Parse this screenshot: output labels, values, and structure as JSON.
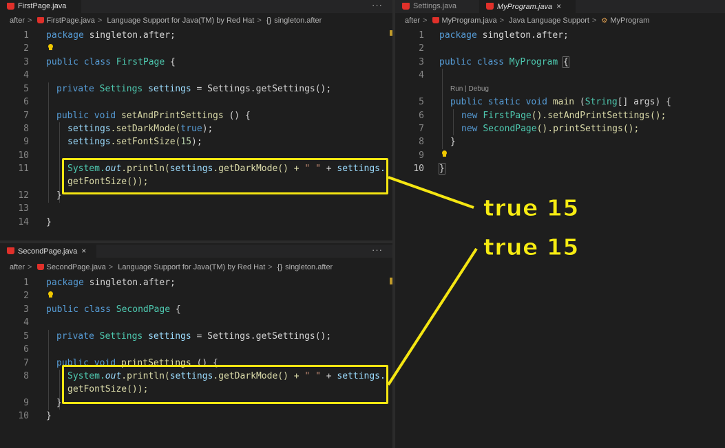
{
  "first": {
    "tab": "FirstPage.java",
    "more": "···",
    "crumbs": [
      "after",
      "FirstPage.java",
      "Language Support for Java(TM) by Red Hat",
      "singleton.after"
    ]
  },
  "second": {
    "tab": "SecondPage.java",
    "more": "···",
    "crumbs": [
      "after",
      "SecondPage.java",
      "Language Support for Java(TM) by Red Hat",
      "singleton.after"
    ]
  },
  "right": {
    "tabs": [
      "Settings.java",
      "MyProgram.java"
    ],
    "crumbs": [
      "after",
      "MyProgram.java",
      "Java Language Support",
      "MyProgram"
    ],
    "codelens": "Run | Debug"
  },
  "line_numbers": {
    "first": [
      "1",
      "2",
      "3",
      "4",
      "5",
      "6",
      "7",
      "8",
      "9",
      "10",
      "11",
      "12",
      "13",
      "14"
    ],
    "second": [
      "1",
      "2",
      "3",
      "4",
      "5",
      "6",
      "7",
      "8",
      "9",
      "10"
    ],
    "right": [
      "1",
      "2",
      "3",
      "4",
      "5",
      "6",
      "7",
      "8",
      "9",
      "10"
    ]
  },
  "code": {
    "package_kw": "package",
    "package_name": " singleton.after;",
    "public": "public",
    "class": "class",
    "private": "private",
    "void": "void",
    "static": "static",
    "new": "new",
    "first": {
      "class_name": "FirstPage",
      "field_type": "Settings",
      "field_name": "settings",
      "field_init": " = Settings.getSettings();",
      "method": "setAndPrintSettings",
      "method_tail": " () {",
      "l8_obj": "settings",
      "l8_call": ".setDarkMode(",
      "l8_arg": "true",
      "l8_end": ");",
      "l9_obj": "settings",
      "l9_call": ".setFontSize(",
      "l9_arg": "15",
      "l9_end": ");",
      "println_a": "System.",
      "println_out": "out",
      "println_b": ".println(",
      "println_c": "settings",
      "println_d": ".getDarkMode() + ",
      "println_str": "\" \"",
      "println_e": " + ",
      "println_f": "settings.",
      "println_cont": "getFontSize());",
      "close_inner": "}",
      "close_outer": "}"
    },
    "second": {
      "class_name": "SecondPage",
      "method": "printSettings",
      "method_tail": " () {",
      "close_inner": "}",
      "close_outer": "}"
    },
    "right": {
      "class_name": "MyProgram",
      "brace": "{",
      "main": "main",
      "main_params_a": " (",
      "main_type": "String",
      "main_params_b": "[] args) {",
      "l6_class": "FirstPage",
      "l6_call": "().setAndPrintSettings();",
      "l7_class": "SecondPage",
      "l7_call": "().printSettings();",
      "close_inner": "}",
      "close_outer": "}"
    }
  },
  "callouts": [
    "true 15",
    "true 15"
  ],
  "colors": {
    "highlight": "#f5e612",
    "background": "#1e1e1e",
    "keyword": "#569cd6",
    "type": "#4ec9b0",
    "function": "#dcdcaa",
    "variable": "#9cdcfe",
    "string": "#ce9178",
    "number": "#b5cea8"
  }
}
